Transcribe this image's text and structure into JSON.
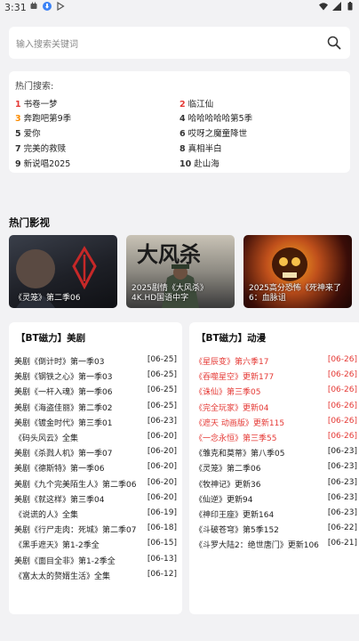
{
  "status_bar": {
    "time": "3:31"
  },
  "search": {
    "placeholder": "输入搜索关键词"
  },
  "hot_search": {
    "title": "热门搜索:",
    "items": [
      {
        "rank": "1",
        "label": "书卷一梦"
      },
      {
        "rank": "2",
        "label": "临江仙"
      },
      {
        "rank": "3",
        "label": "奔跑吧第9季"
      },
      {
        "rank": "4",
        "label": "哈哈哈哈哈第5季"
      },
      {
        "rank": "5",
        "label": "爱你"
      },
      {
        "rank": "6",
        "label": "哎呀之魔童降世"
      },
      {
        "rank": "7",
        "label": "完美的救赎"
      },
      {
        "rank": "8",
        "label": "真相半白"
      },
      {
        "rank": "9",
        "label": "新说唱2025"
      },
      {
        "rank": "10",
        "label": "赴山海"
      }
    ]
  },
  "hot_movies": {
    "title": "热门影视",
    "cards": [
      {
        "caption": "《灵笼》第二季06"
      },
      {
        "caption": "2025剧情《大风杀》4K.HD国语中字"
      },
      {
        "caption": "2025高分恐怖《死神来了6：血脉诅"
      }
    ]
  },
  "panels": [
    {
      "title": "【BT磁力】美剧",
      "rows": [
        {
          "title": "美剧《倒计时》第一季03",
          "date": "[06-25]",
          "highlight": false
        },
        {
          "title": "美剧《钢铁之心》第一季03",
          "date": "[06-25]",
          "highlight": false
        },
        {
          "title": "美剧《一杆入魂》第一季06",
          "date": "[06-25]",
          "highlight": false
        },
        {
          "title": "美剧《海盗佳丽》第二季02",
          "date": "[06-25]",
          "highlight": false
        },
        {
          "title": "美剧《镀金时代》第三季01",
          "date": "[06-23]",
          "highlight": false
        },
        {
          "title": "《码头风云》全集",
          "date": "[06-20]",
          "highlight": false
        },
        {
          "title": "美剧《杀戮人机》第一季07",
          "date": "[06-20]",
          "highlight": false
        },
        {
          "title": "美剧《德斯特》第一季06",
          "date": "[06-20]",
          "highlight": false
        },
        {
          "title": "美剧《九个完美陌生人》第二季06",
          "date": "[06-20]",
          "highlight": false
        },
        {
          "title": "美剧《就这样》第三季04",
          "date": "[06-20]",
          "highlight": false
        },
        {
          "title": "《说谎的人》全集",
          "date": "[06-19]",
          "highlight": false
        },
        {
          "title": "美剧《行尸走肉：死城》第二季07",
          "date": "[06-18]",
          "highlight": false
        },
        {
          "title": "《黑手遮天》第1-2季全",
          "date": "[06-15]",
          "highlight": false
        },
        {
          "title": "美剧《面目全非》第1-2季全",
          "date": "[06-13]",
          "highlight": false
        },
        {
          "title": "《富太太的赘婿生活》全集",
          "date": "[06-12]",
          "highlight": false
        }
      ]
    },
    {
      "title": "【BT磁力】动漫",
      "rows": [
        {
          "title": "《星辰变》第六季17",
          "date": "[06-26]",
          "highlight": true
        },
        {
          "title": "《吞噬星空》更新177",
          "date": "[06-26]",
          "highlight": true
        },
        {
          "title": "《诛仙》第三季05",
          "date": "[06-26]",
          "highlight": true
        },
        {
          "title": "《完全玩家》更新04",
          "date": "[06-26]",
          "highlight": true
        },
        {
          "title": "《遮天 动画版》更新115",
          "date": "[06-26]",
          "highlight": true
        },
        {
          "title": "《一念永恒》第三季55",
          "date": "[06-26]",
          "highlight": true
        },
        {
          "title": "《雏克和莫蒂》第八季05",
          "date": "[06-23]",
          "highlight": false
        },
        {
          "title": "《灵笼》第二季06",
          "date": "[06-23]",
          "highlight": false
        },
        {
          "title": "《牧神记》更新36",
          "date": "[06-23]",
          "highlight": false
        },
        {
          "title": "《仙逆》更新94",
          "date": "[06-23]",
          "highlight": false
        },
        {
          "title": "《神印王座》更新164",
          "date": "[06-23]",
          "highlight": false
        },
        {
          "title": "《斗破苍穹》第5季152",
          "date": "[06-22]",
          "highlight": false
        },
        {
          "title": "《斗罗大陆2：绝世唐门》更新106",
          "date": "[06-21]",
          "highlight": false
        }
      ]
    }
  ],
  "colors": {
    "highlight": "#e53935",
    "rank1": "#e53935",
    "rank3": "#fb8c00",
    "background": "#f2f2f4"
  }
}
